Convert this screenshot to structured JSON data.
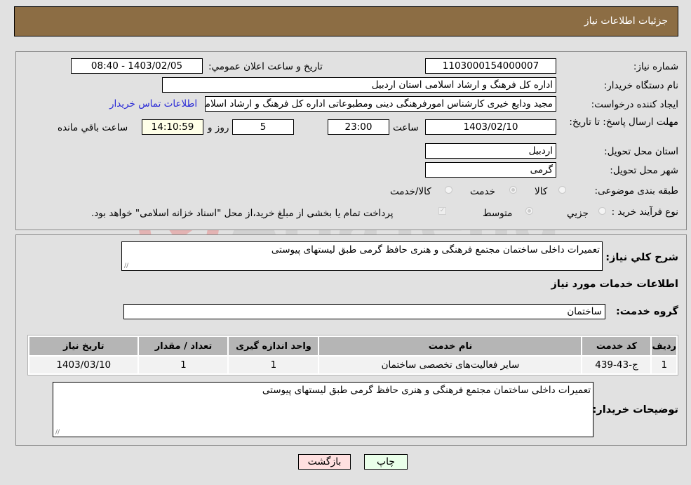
{
  "header": {
    "title": "جزئیات اطلاعات نیاز"
  },
  "details": {
    "need_number_label": "شماره نیاز:",
    "need_number": "1103000154000007",
    "announce_label": "تاريخ و ساعت اعلان عمومي:",
    "announce_value": "1403/02/05 - 08:40",
    "buyer_org_label": "نام دستگاه خریدار:",
    "buyer_org": "اداره کل فرهنگ و ارشاد اسلامی استان اردبیل",
    "requester_label": "ایجاد کننده درخواست:",
    "requester": "مجید  ودایع خیری کارشناس امورفرهنگی دینی ومطبوعاتی اداره کل فرهنگ و ارشاد اسلامی استان اردبیل",
    "contact_link": "اطلاعات تماس خریدار",
    "deadline_label": "مهلت ارسال پاسخ: تا تاریخ:",
    "deadline_date": "1403/02/10",
    "time_label": "ساعت",
    "deadline_time": "23:00",
    "days_value": "5",
    "days_label": "روز و",
    "remaining_time": "14:10:59",
    "remaining_label": "ساعت باقي مانده",
    "province_label": "استان محل تحویل:",
    "province": "اردبیل",
    "city_label": "شهر محل تحویل:",
    "city": "گرمی",
    "category_label": "طبقه بندی موضوعی:",
    "category_options": [
      {
        "label": "کالا",
        "checked": false
      },
      {
        "label": "خدمت",
        "checked": true
      },
      {
        "label": "کالا/خدمت",
        "checked": false
      }
    ],
    "process_label": "نوع فرآیند خرید :",
    "process_options": [
      {
        "label": "جزيي",
        "checked": false
      },
      {
        "label": "متوسط",
        "checked": true
      }
    ],
    "treasury_note": "پرداخت تمام یا بخشی از مبلغ خرید،از محل \"اسناد خزانه اسلامی\" خواهد بود.",
    "treasury_checked": true
  },
  "summary": {
    "general_desc_label": "شرح كلي نياز:",
    "general_desc": "تعمیرات داخلی ساختمان مجتمع فرهنگی و هنری  حافظ گرمی طبق لیستهای پیوستی",
    "services_heading": "اطلاعات خدمات مورد نياز",
    "service_group_label": "گروه خدمت:",
    "service_group": "ساختمان",
    "table": {
      "headers": [
        "رديف",
        "کد خدمت",
        "نام خدمت",
        "واحد اندازه گیری",
        "تعداد / مقدار",
        "تاریخ نیاز"
      ],
      "rows": [
        [
          "1",
          "ج-43-439",
          "سایر فعالیت‌های تخصصی ساختمان",
          "1",
          "1",
          "1403/03/10"
        ]
      ]
    },
    "buyer_notes_label": "توضیحات خریدار:",
    "buyer_notes": "تعمیرات داخلی ساختمان مجتمع فرهنگی و هنری  حافظ گرمی طبق لیستهای پیوستی"
  },
  "buttons": {
    "print": "چاپ",
    "back": "بازگشت"
  },
  "watermark": {
    "text": "AriaTender.net"
  },
  "colors": {
    "header_bg": "#8c6d44",
    "print_bg": "#eaffea",
    "back_bg": "#ffe0e0",
    "link": "#2b2bd6"
  }
}
